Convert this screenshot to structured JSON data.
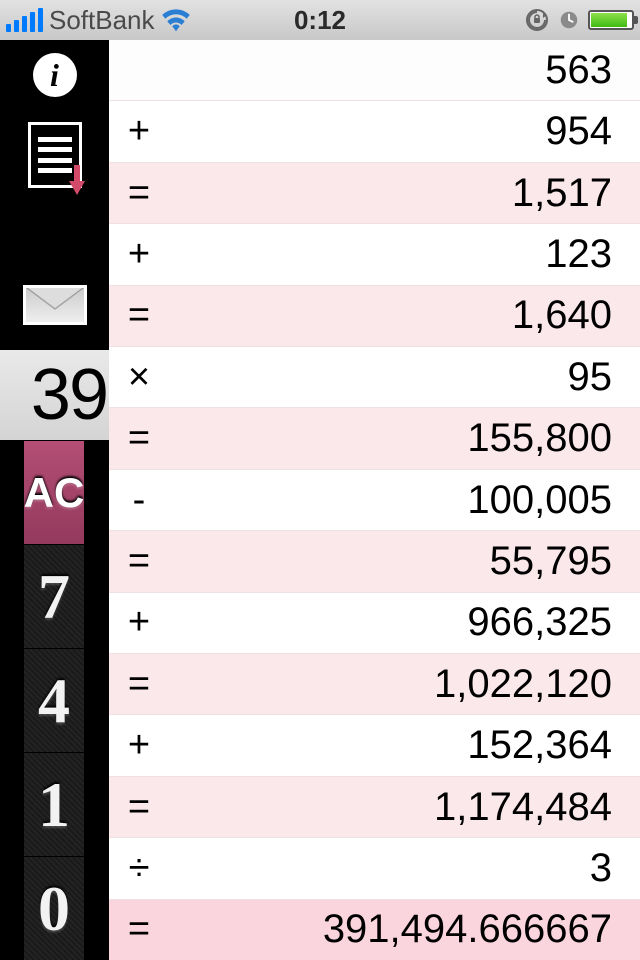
{
  "status": {
    "carrier": "SoftBank",
    "time": "0:12"
  },
  "sidebar": {
    "info_glyph": "i"
  },
  "display": {
    "partial_value": "39"
  },
  "keys": {
    "ac": "AC",
    "k7": "7",
    "k4": "4",
    "k1": "1",
    "k0": "0"
  },
  "history": [
    {
      "op": "",
      "val": "563",
      "kind": "plain"
    },
    {
      "op": "+",
      "val": "954",
      "kind": "plain"
    },
    {
      "op": "=",
      "val": "1,517",
      "kind": "eq"
    },
    {
      "op": "+",
      "val": "123",
      "kind": "plain"
    },
    {
      "op": "=",
      "val": "1,640",
      "kind": "eq"
    },
    {
      "op": "×",
      "val": "95",
      "kind": "plain"
    },
    {
      "op": "=",
      "val": "155,800",
      "kind": "eq"
    },
    {
      "op": "-",
      "val": "100,005",
      "kind": "plain"
    },
    {
      "op": "=",
      "val": "55,795",
      "kind": "eq"
    },
    {
      "op": "+",
      "val": "966,325",
      "kind": "plain"
    },
    {
      "op": "=",
      "val": "1,022,120",
      "kind": "eq"
    },
    {
      "op": "+",
      "val": "152,364",
      "kind": "plain"
    },
    {
      "op": "=",
      "val": "1,174,484",
      "kind": "eq"
    },
    {
      "op": "÷",
      "val": "3",
      "kind": "plain"
    },
    {
      "op": "=",
      "val": "391,494.666667",
      "kind": "final"
    }
  ]
}
